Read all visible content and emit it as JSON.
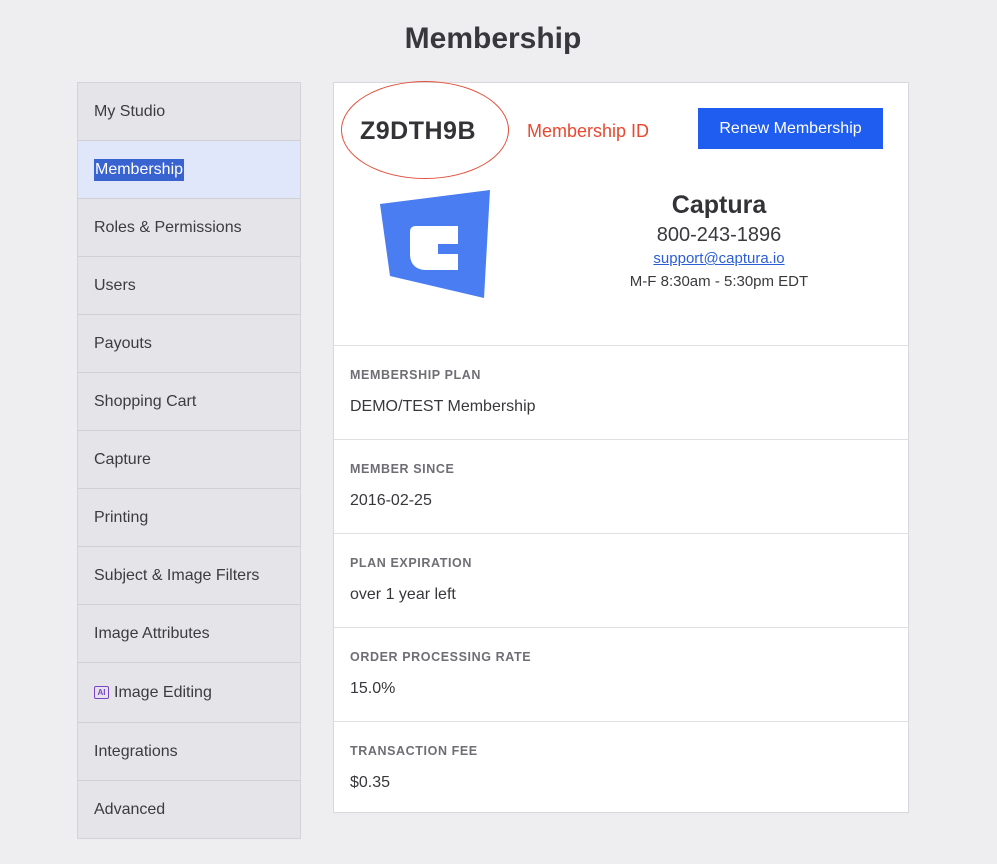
{
  "page": {
    "title": "Membership"
  },
  "sidebar": {
    "items": [
      {
        "label": "My Studio"
      },
      {
        "label": "Membership"
      },
      {
        "label": "Roles & Permissions"
      },
      {
        "label": "Users"
      },
      {
        "label": "Payouts"
      },
      {
        "label": "Shopping Cart"
      },
      {
        "label": "Capture"
      },
      {
        "label": "Printing"
      },
      {
        "label": "Subject & Image Filters"
      },
      {
        "label": "Image Attributes"
      },
      {
        "label": "Image Editing",
        "badge": "AI"
      },
      {
        "label": "Integrations"
      },
      {
        "label": "Advanced"
      }
    ],
    "active_index": 1
  },
  "membership": {
    "id": "Z9DTH9B",
    "id_annotation": "Membership ID",
    "renew_label": "Renew Membership",
    "company": {
      "name": "Captura",
      "phone": "800-243-1896",
      "email": "support@captura.io",
      "hours": "M-F 8:30am - 5:30pm EDT"
    },
    "details": [
      {
        "label": "MEMBERSHIP PLAN",
        "value": "DEMO/TEST Membership"
      },
      {
        "label": "MEMBER SINCE",
        "value": "2016-02-25"
      },
      {
        "label": "PLAN EXPIRATION",
        "value": "over 1 year left"
      },
      {
        "label": "ORDER PROCESSING RATE",
        "value": "15.0%"
      },
      {
        "label": "TRANSACTION FEE",
        "value": "$0.35"
      }
    ]
  },
  "colors": {
    "accent": "#1f5cf0",
    "logo": "#4a7cf2",
    "annotation": "#e8492e",
    "ai_badge": "#7a43c9"
  }
}
